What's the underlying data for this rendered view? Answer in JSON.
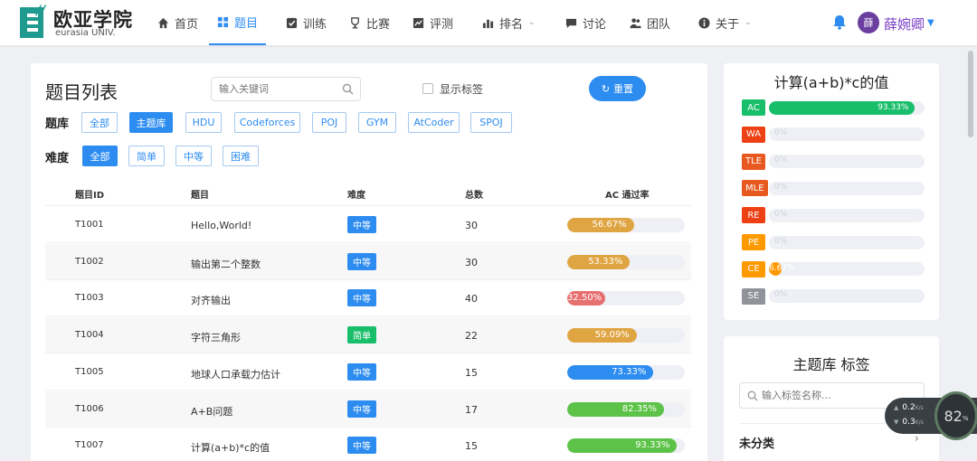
{
  "brand": {
    "cn": "欧亚学院",
    "en": "eurasia UNIV.",
    "quote": "//"
  },
  "nav": [
    {
      "label": "首页",
      "icon": "home-icon"
    },
    {
      "label": "题目",
      "icon": "grid-icon",
      "active": true
    },
    {
      "label": "训练",
      "icon": "check-square-icon"
    },
    {
      "label": "比赛",
      "icon": "trophy-icon"
    },
    {
      "label": "评测",
      "icon": "chart-line-icon"
    },
    {
      "label": "排名",
      "icon": "bar-chart-icon",
      "dropdown": true
    },
    {
      "label": "讨论",
      "icon": "message-icon"
    },
    {
      "label": "团队",
      "icon": "team-icon"
    },
    {
      "label": "关于",
      "icon": "info-icon",
      "dropdown": true
    }
  ],
  "user": {
    "avatar_text": "薛",
    "name": "薛婉卿",
    "avatar_color": "#6b3fa0"
  },
  "main": {
    "title": "题目列表",
    "search_placeholder": "输入关键词",
    "show_tags_label": "显示标签",
    "reset_label": "重置",
    "source_label": "题库",
    "sources": [
      "全部",
      "主题库",
      "HDU",
      "Codeforces",
      "POJ",
      "GYM",
      "AtCoder",
      "SPOJ"
    ],
    "difficulty_label": "难度",
    "difficulties": [
      "全部",
      "简单",
      "中等",
      "困难"
    ],
    "columns": [
      "题目ID",
      "题目",
      "难度",
      "总数",
      "AC 通过率"
    ],
    "rows": [
      {
        "id": "T1001",
        "title": "Hello,World!",
        "difficulty": "中等",
        "total": "30",
        "rate_text": "56.67%",
        "rate": 56.67,
        "color": "#e0a543"
      },
      {
        "id": "T1002",
        "title": "输出第二个整数",
        "difficulty": "中等",
        "total": "30",
        "rate_text": "53.33%",
        "rate": 53.33,
        "color": "#e0a543"
      },
      {
        "id": "T1003",
        "title": "对齐输出",
        "difficulty": "中等",
        "total": "40",
        "rate_text": "32.50%",
        "rate": 32.5,
        "color": "#e86f6f"
      },
      {
        "id": "T1004",
        "title": "字符三角形",
        "difficulty": "简单",
        "total": "22",
        "rate_text": "59.09%",
        "rate": 59.09,
        "color": "#e0a543"
      },
      {
        "id": "T1005",
        "title": "地球人口承载力估计",
        "difficulty": "中等",
        "total": "15",
        "rate_text": "73.33%",
        "rate": 73.33,
        "color": "#2d8cf0"
      },
      {
        "id": "T1006",
        "title": "A+B问题",
        "difficulty": "中等",
        "total": "17",
        "rate_text": "82.35%",
        "rate": 82.35,
        "color": "#5cc348"
      },
      {
        "id": "T1007",
        "title": "计算(a+b)*c的值",
        "difficulty": "中等",
        "total": "15",
        "rate_text": "93.33%",
        "rate": 93.33,
        "color": "#5cc348"
      }
    ],
    "difficulty_colors": {
      "中等": "#2d8cf0",
      "简单": "#19be6b"
    }
  },
  "stats": {
    "title": "计算(a+b)*c的值",
    "items": [
      {
        "label": "AC",
        "color": "#19be6b",
        "value_text": "93.33%",
        "value": 93.33
      },
      {
        "label": "WA",
        "color": "#ed4014",
        "value_text": "0%",
        "value": 0
      },
      {
        "label": "TLE",
        "color": "#e8591f",
        "value_text": "0%",
        "value": 0
      },
      {
        "label": "MLE",
        "color": "#e8591f",
        "value_text": "0%",
        "value": 0
      },
      {
        "label": "RE",
        "color": "#ed4014",
        "value_text": "0%",
        "value": 0
      },
      {
        "label": "PE",
        "color": "#ff9900",
        "value_text": "0%",
        "value": 0
      },
      {
        "label": "CE",
        "color": "#ff9900",
        "value_text": "6.67%",
        "value": 6.67
      },
      {
        "label": "SE",
        "color": "#909399",
        "value_text": "0%",
        "value": 0
      }
    ]
  },
  "tags": {
    "title": "主题库 标签",
    "search_placeholder": "输入标签名称...",
    "uncategorized": "未分类"
  },
  "speed": {
    "up": "0.2",
    "down": "0.3",
    "unit": "K/s",
    "percent": "82",
    "percent_unit": "%"
  }
}
